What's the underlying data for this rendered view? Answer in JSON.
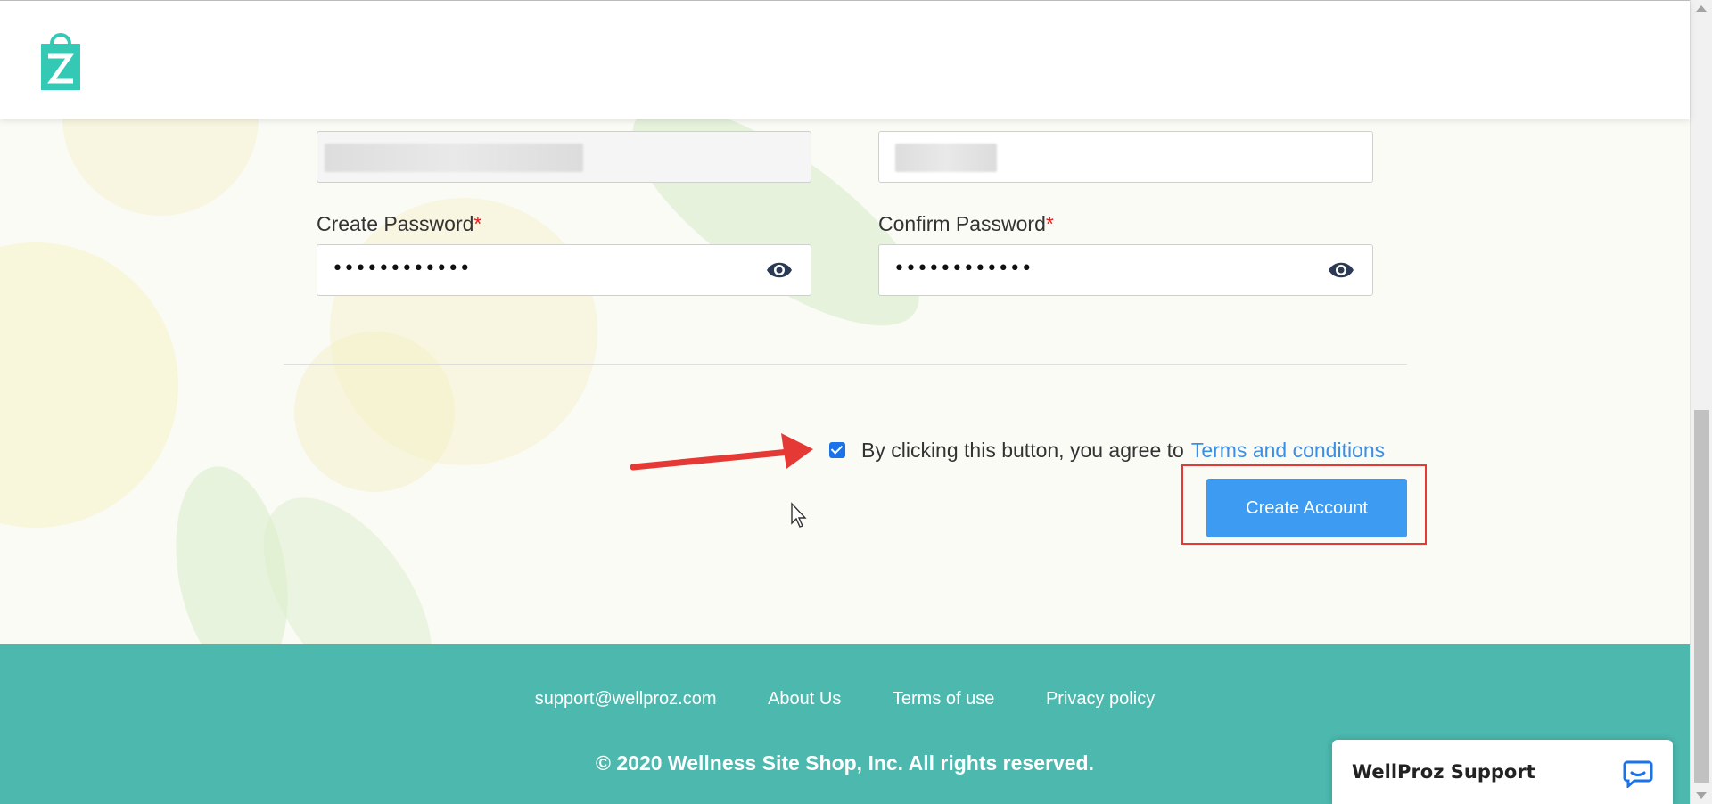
{
  "header": {
    "logo_icon": "wellproz-bag-logo-icon"
  },
  "form": {
    "create_password_label": "Create Password",
    "confirm_password_label": "Confirm Password",
    "required_mark": "*",
    "create_password_value": "••••••••••••",
    "confirm_password_value": "••••••••••••",
    "show_password_icon": "eye-icon"
  },
  "agreement": {
    "checked": true,
    "text": "By clicking this button, you agree to",
    "link": "Terms and conditions"
  },
  "create_account_label": "Create Account",
  "footer": {
    "links": [
      "support@wellproz.com",
      "About Us",
      "Terms of use",
      "Privacy policy"
    ],
    "copyright": "© 2020 Wellness Site Shop, Inc. All rights reserved."
  },
  "support_widget": {
    "title": "WellProz Support",
    "icon": "chat-bubble-icon"
  },
  "colors": {
    "primary": "#3d9cf2",
    "footer": "#4cb8ae",
    "logo": "#34c9b4",
    "highlight": "#e53935"
  }
}
